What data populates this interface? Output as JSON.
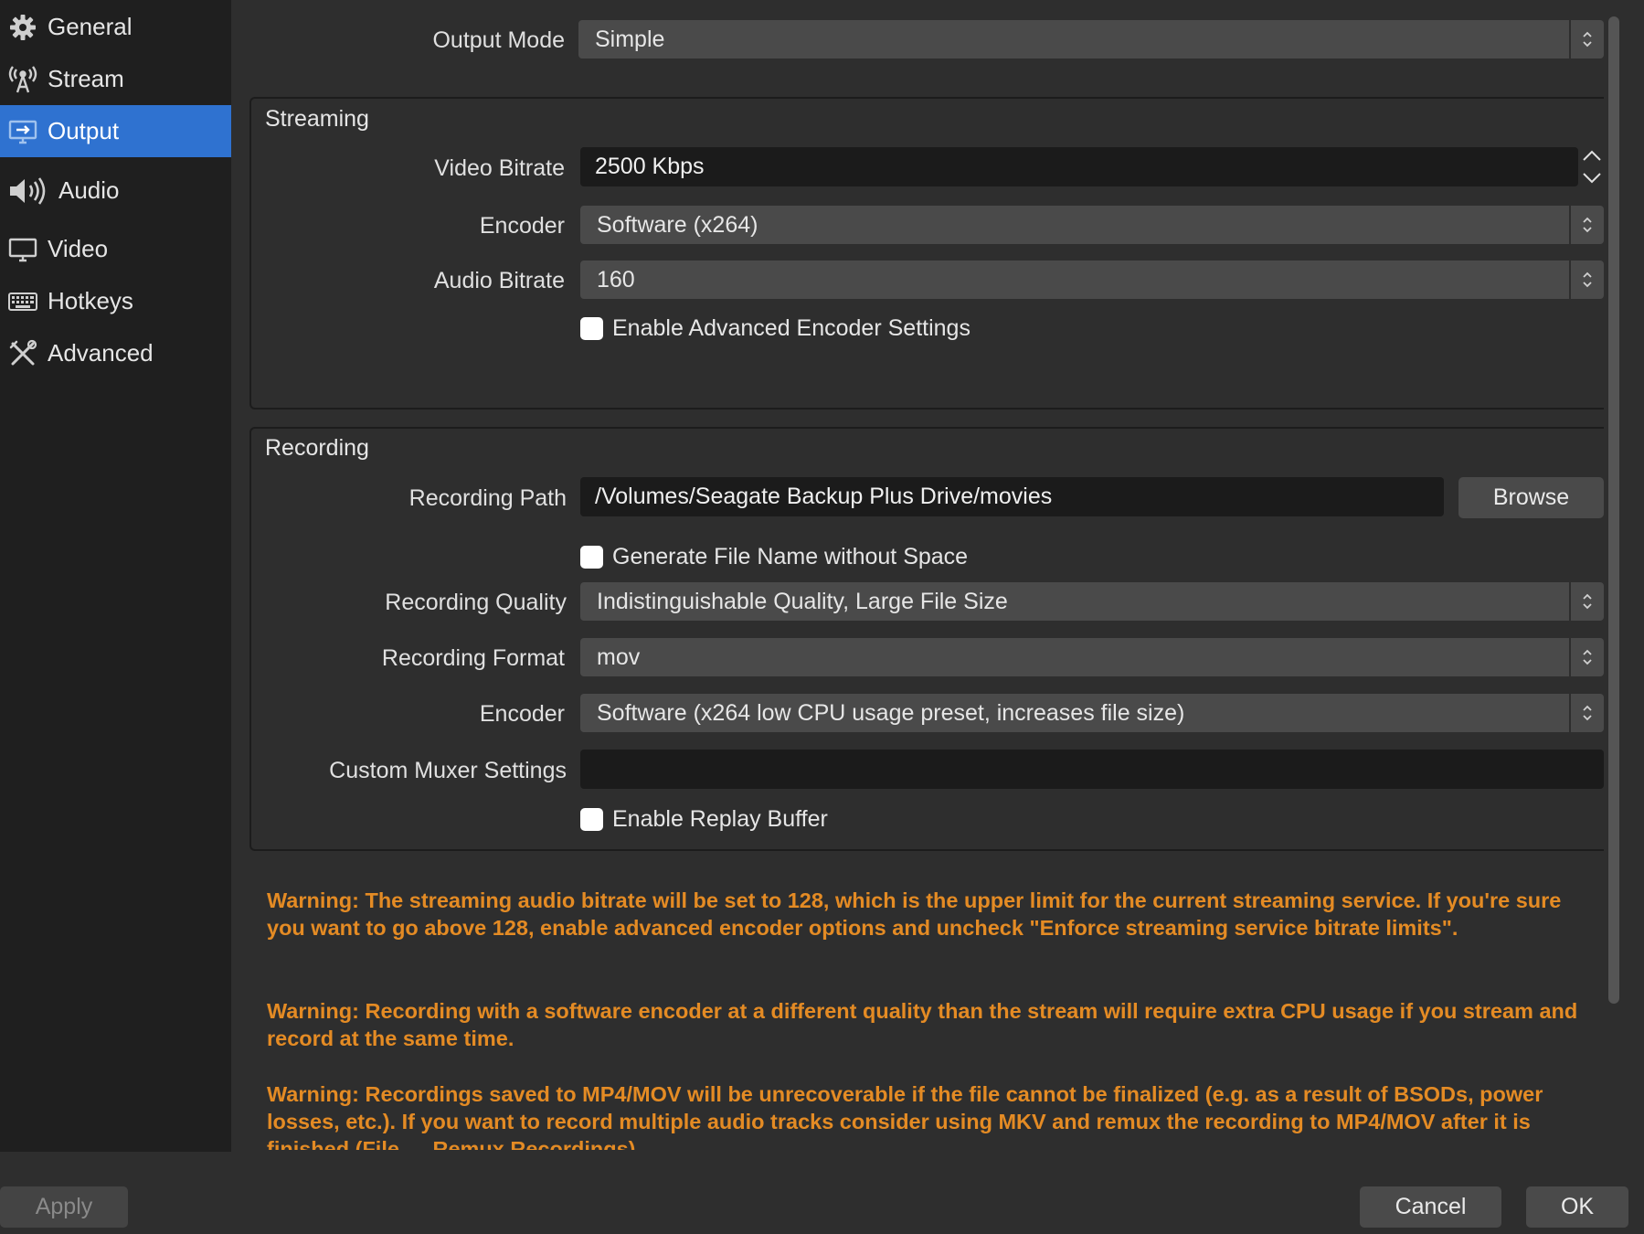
{
  "sidebar": {
    "items": [
      {
        "label": "General",
        "icon": "gear-icon"
      },
      {
        "label": "Stream",
        "icon": "antenna-icon"
      },
      {
        "label": "Output",
        "icon": "monitor-arrow-icon",
        "active": true
      },
      {
        "label": "Audio",
        "icon": "speaker-icon"
      },
      {
        "label": "Video",
        "icon": "monitor-icon"
      },
      {
        "label": "Hotkeys",
        "icon": "keyboard-icon"
      },
      {
        "label": "Advanced",
        "icon": "tools-icon"
      }
    ]
  },
  "output_mode": {
    "label": "Output Mode",
    "value": "Simple"
  },
  "streaming": {
    "title": "Streaming",
    "video_bitrate": {
      "label": "Video Bitrate",
      "value": "2500 Kbps"
    },
    "encoder": {
      "label": "Encoder",
      "value": "Software (x264)"
    },
    "audio_bitrate": {
      "label": "Audio Bitrate",
      "value": "160"
    },
    "advanced_encoder": {
      "label": "Enable Advanced Encoder Settings",
      "checked": false
    }
  },
  "recording": {
    "title": "Recording",
    "path": {
      "label": "Recording Path",
      "value": "/Volumes/Seagate Backup Plus Drive/movies"
    },
    "browse_label": "Browse",
    "no_space": {
      "label": "Generate File Name without Space",
      "checked": false
    },
    "quality": {
      "label": "Recording Quality",
      "value": "Indistinguishable Quality, Large File Size"
    },
    "format": {
      "label": "Recording Format",
      "value": "mov"
    },
    "encoder": {
      "label": "Encoder",
      "value": "Software (x264 low CPU usage preset, increases file size)"
    },
    "muxer": {
      "label": "Custom Muxer Settings",
      "value": ""
    },
    "replay_buffer": {
      "label": "Enable Replay Buffer",
      "checked": false
    }
  },
  "warnings": [
    "Warning: The streaming audio bitrate will be set to 128, which is the upper limit for the current streaming service. If you're sure you want to go above 128, enable advanced encoder options and uncheck \"Enforce streaming service bitrate limits\".",
    "Warning: Recording with a software encoder at a different quality than the stream will require extra CPU usage if you stream and record at the same time.",
    "Warning: Recordings saved to MP4/MOV will be unrecoverable if the file cannot be finalized (e.g. as a result of BSODs, power losses, etc.). If you want to record multiple audio tracks consider using MKV and remux the recording to MP4/MOV after it is finished (File → Remux Recordings)"
  ],
  "footer": {
    "apply_label": "Apply",
    "cancel_label": "Cancel",
    "ok_label": "OK"
  },
  "colors": {
    "accent": "#2f72d0",
    "warning": "#e48b24",
    "background": "#2e2e2e",
    "sidebar": "#1f1f1f"
  }
}
